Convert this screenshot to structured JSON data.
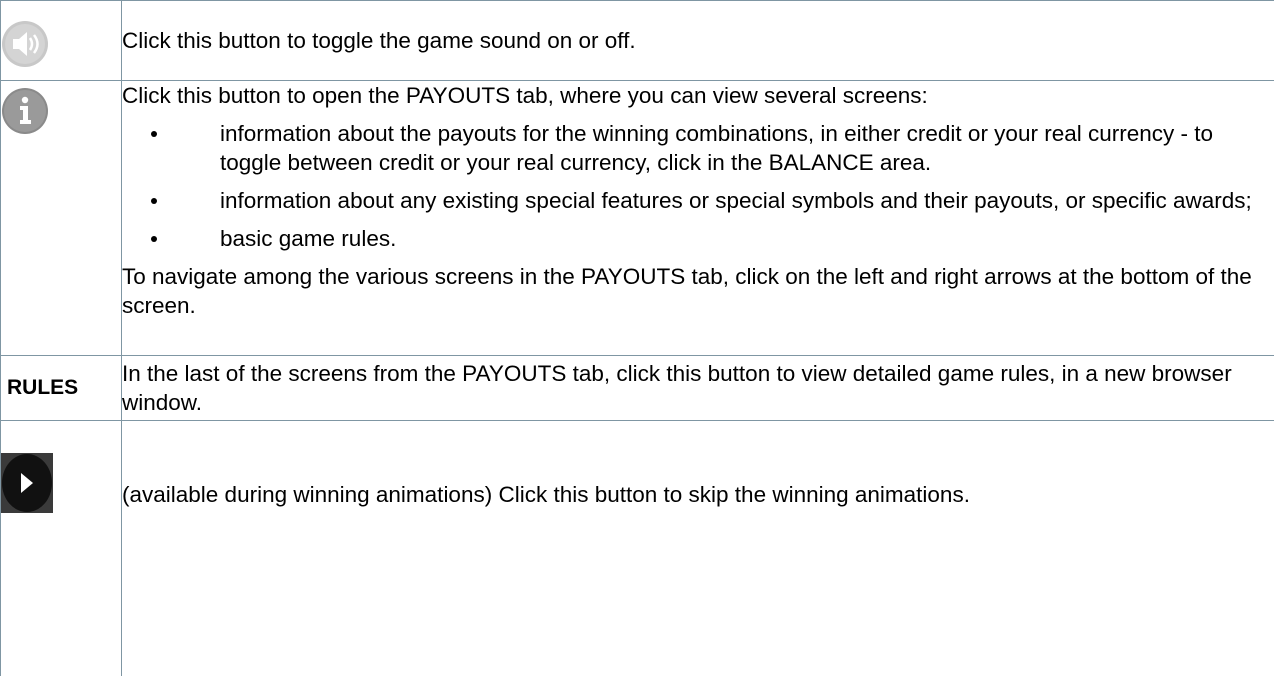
{
  "rows": {
    "sound": {
      "icon": "speaker-icon",
      "text": "Click this button to toggle the game sound on or off."
    },
    "info": {
      "icon": "info-icon",
      "intro": "Click this button to open the PAYOUTS tab, where you can view several screens:",
      "bullets": [
        "information about the payouts for the winning combinations, in either credit or your real currency - to toggle between credit or your real currency, click in the BALANCE area.",
        "information about any existing special features or special symbols and their payouts, or specific awards;",
        "basic game rules."
      ],
      "outro": "To navigate among the various screens in the PAYOUTS tab, click on the left and right arrows at the bottom of the screen."
    },
    "rules": {
      "label": "RULES",
      "text": "In the last of the screens from the PAYOUTS tab, click this button to view detailed game rules, in a new browser window."
    },
    "skip": {
      "icon": "skip-forward-icon",
      "text": "(available during winning animations) Click this button to skip the winning animations."
    }
  },
  "colors": {
    "border": "#7f96a3",
    "sound_icon": "#c8c8c8",
    "info_icon": "#8a8a8a",
    "skip_icon_bg": "#1a1a1a"
  }
}
